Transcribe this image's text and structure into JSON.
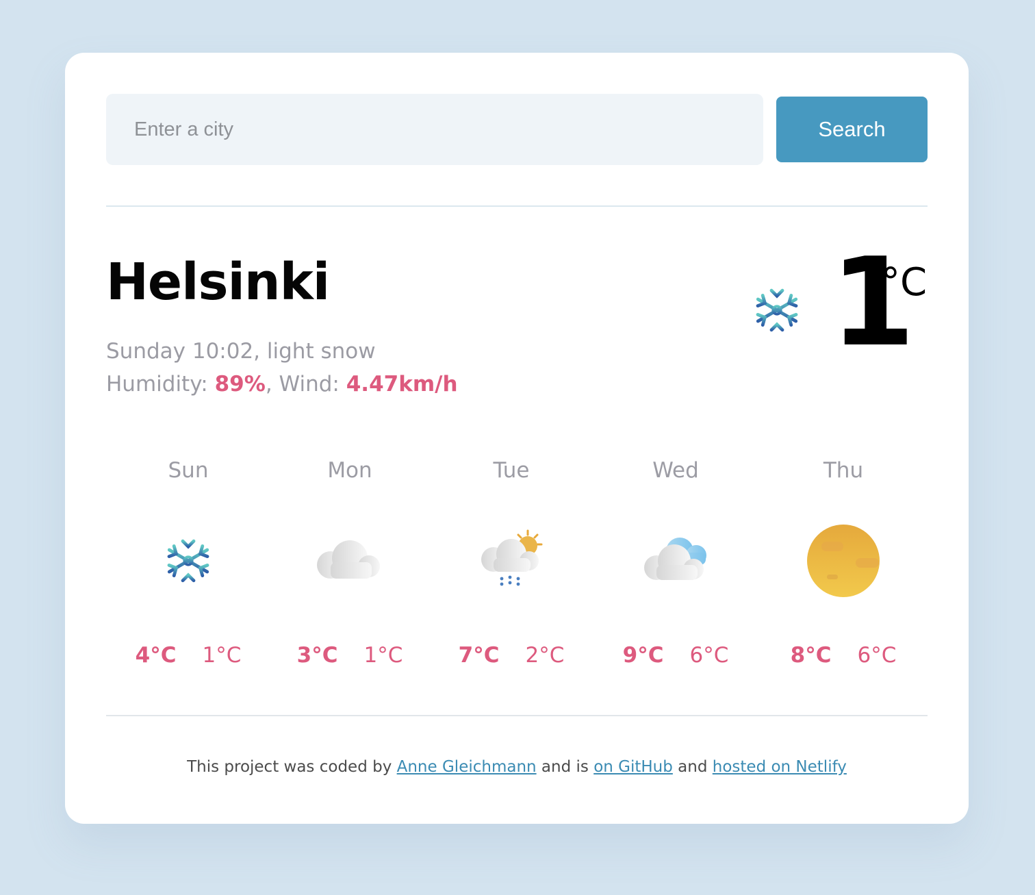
{
  "search": {
    "placeholder": "Enter a city",
    "button_label": "Search"
  },
  "current": {
    "city": "Helsinki",
    "day_time_condition": "Sunday 10:02, light snow",
    "humidity_label": "Humidity: ",
    "humidity_value": "89%",
    "wind_label": ", Wind: ",
    "wind_value": "4.47km/h",
    "temperature": "1",
    "unit": "°C",
    "icon": "snow-icon"
  },
  "forecast": [
    {
      "day": "Sun",
      "max": "4°C",
      "min": "1°C",
      "icon": "snow-icon"
    },
    {
      "day": "Mon",
      "max": "3°C",
      "min": "1°C",
      "icon": "cloud-icon"
    },
    {
      "day": "Tue",
      "max": "7°C",
      "min": "2°C",
      "icon": "sun-cloud-rain-icon"
    },
    {
      "day": "Wed",
      "max": "9°C",
      "min": "6°C",
      "icon": "clouds-icon"
    },
    {
      "day": "Thu",
      "max": "8°C",
      "min": "6°C",
      "icon": "haze-sun-icon"
    }
  ],
  "footer": {
    "prefix": "This project was coded by ",
    "author_link": "Anne Gleichmann",
    "middle1": " and is ",
    "github_link": "on GitHub",
    "middle2": " and ",
    "netlify_link": "hosted on Netlify"
  },
  "colors": {
    "accent": "#4799c0",
    "highlight": "#dd5a7e",
    "background": "#d3e3ef"
  }
}
